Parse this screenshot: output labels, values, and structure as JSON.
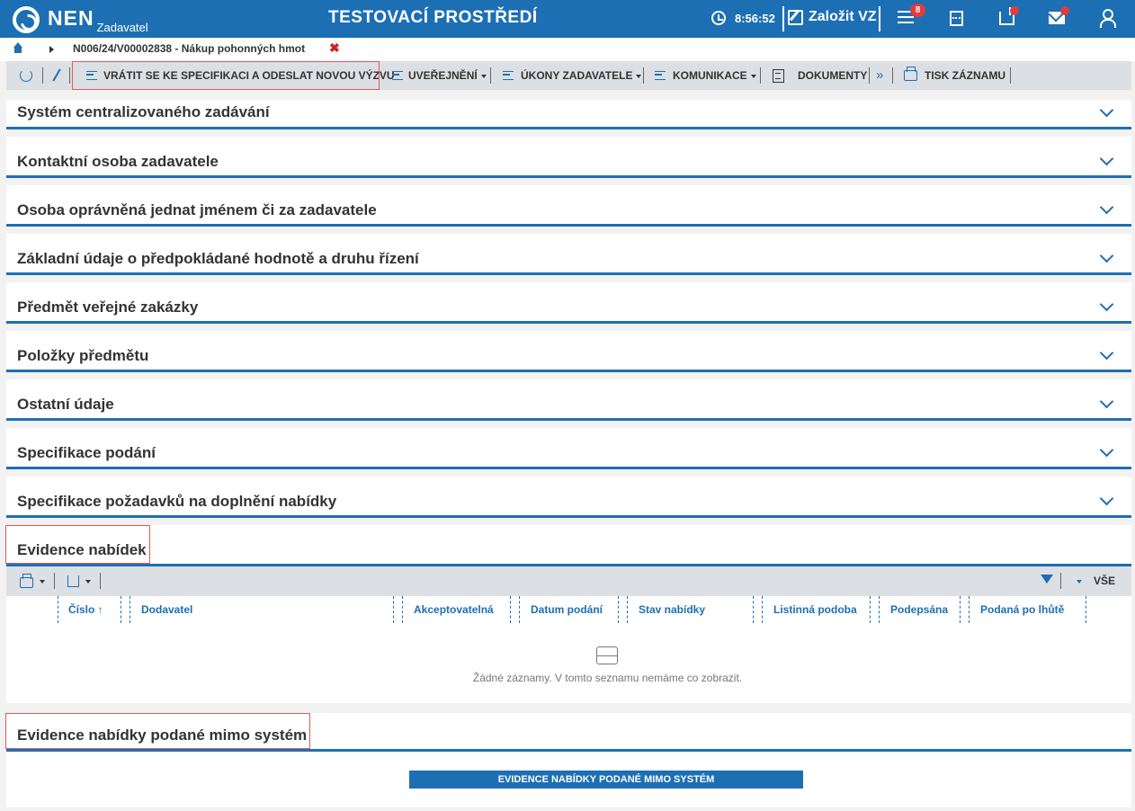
{
  "header": {
    "logo": "NEN",
    "logo_sub": "Zadavatel",
    "env_title": "TESTOVACÍ PROSTŘEDÍ",
    "time": "8:56:52",
    "new_label": "Založit VZ",
    "menu_badge": "8",
    "brand_color": "#1d6fb3",
    "badge_color": "#e23b3b"
  },
  "breadcrumb": {
    "record": "N006/24/V00002838 - Nákup pohonných hmot",
    "close": "✖"
  },
  "toolbar": {
    "return_label": "VRÁTIT SE KE SPECIFIKACI A ODESLAT NOVOU VÝZVU",
    "publish_label": "UVEŘEJNĚNÍ",
    "acts_label": "ÚKONY ZADAVATELE",
    "comm_label": "KOMUNIKACE",
    "docs_label": "DOKUMENTY",
    "more_label": "»",
    "print_label": "TISK ZÁZNAMU"
  },
  "sections": [
    "Systém centralizovaného zadávání",
    "Kontaktní osoba zadavatele",
    "Osoba oprávněná jednat jménem či za zadavatele",
    "Základní údaje o předpokládané hodnotě a druhu řízení",
    "Předmět veřejné zakázky",
    "Položky předmětu",
    "Ostatní údaje",
    "Specifikace podání",
    "Specifikace požadavků na doplnění nabídky"
  ],
  "offers": {
    "title": "Evidence nabídek",
    "filter_all": "VŠE",
    "columns": [
      "Číslo ↑",
      "Dodavatel",
      "Akceptovatelná",
      "Datum podání",
      "Stav nabídky",
      "Listinná podoba",
      "Podepsána",
      "Podaná po lhůtě"
    ],
    "empty_text": "Žádné záznamy. V tomto seznamu nemáme co zobrazit."
  },
  "outside": {
    "title": "Evidence nabídky podané mimo systém",
    "button": "EVIDENCE NABÍDKY PODANÉ MIMO SYSTÉM"
  }
}
